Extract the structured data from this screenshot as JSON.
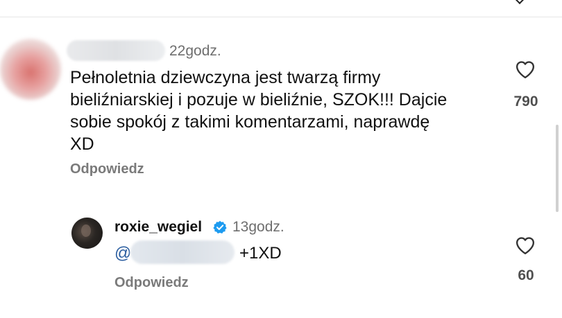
{
  "comment": {
    "time": "22godz.",
    "lines": [
      "Pełnoletnia dziewczyna jest twarzą firmy",
      "bieliźniarskiej i pozuje w bieliźnie, SZOK!!! Dajcie",
      "sobie spokój z takimi komentarzami, naprawdę",
      "XD"
    ],
    "reply_label": "Odpowiedz",
    "like_count": "790"
  },
  "reply": {
    "username": "roxie_wegiel",
    "verified": true,
    "time": "13godz.",
    "mention_prefix": "@",
    "text": "+1XD",
    "reply_label": "Odpowiedz",
    "like_count": "60"
  },
  "icons": {
    "like": "heart-outline-icon",
    "verified": "verified-badge-icon",
    "top_right": "chevron-icon"
  },
  "colors": {
    "verified_blue": "#1d9bf0",
    "mention_blue": "#2a5d9f",
    "secondary_text": "#6e6e6e"
  }
}
